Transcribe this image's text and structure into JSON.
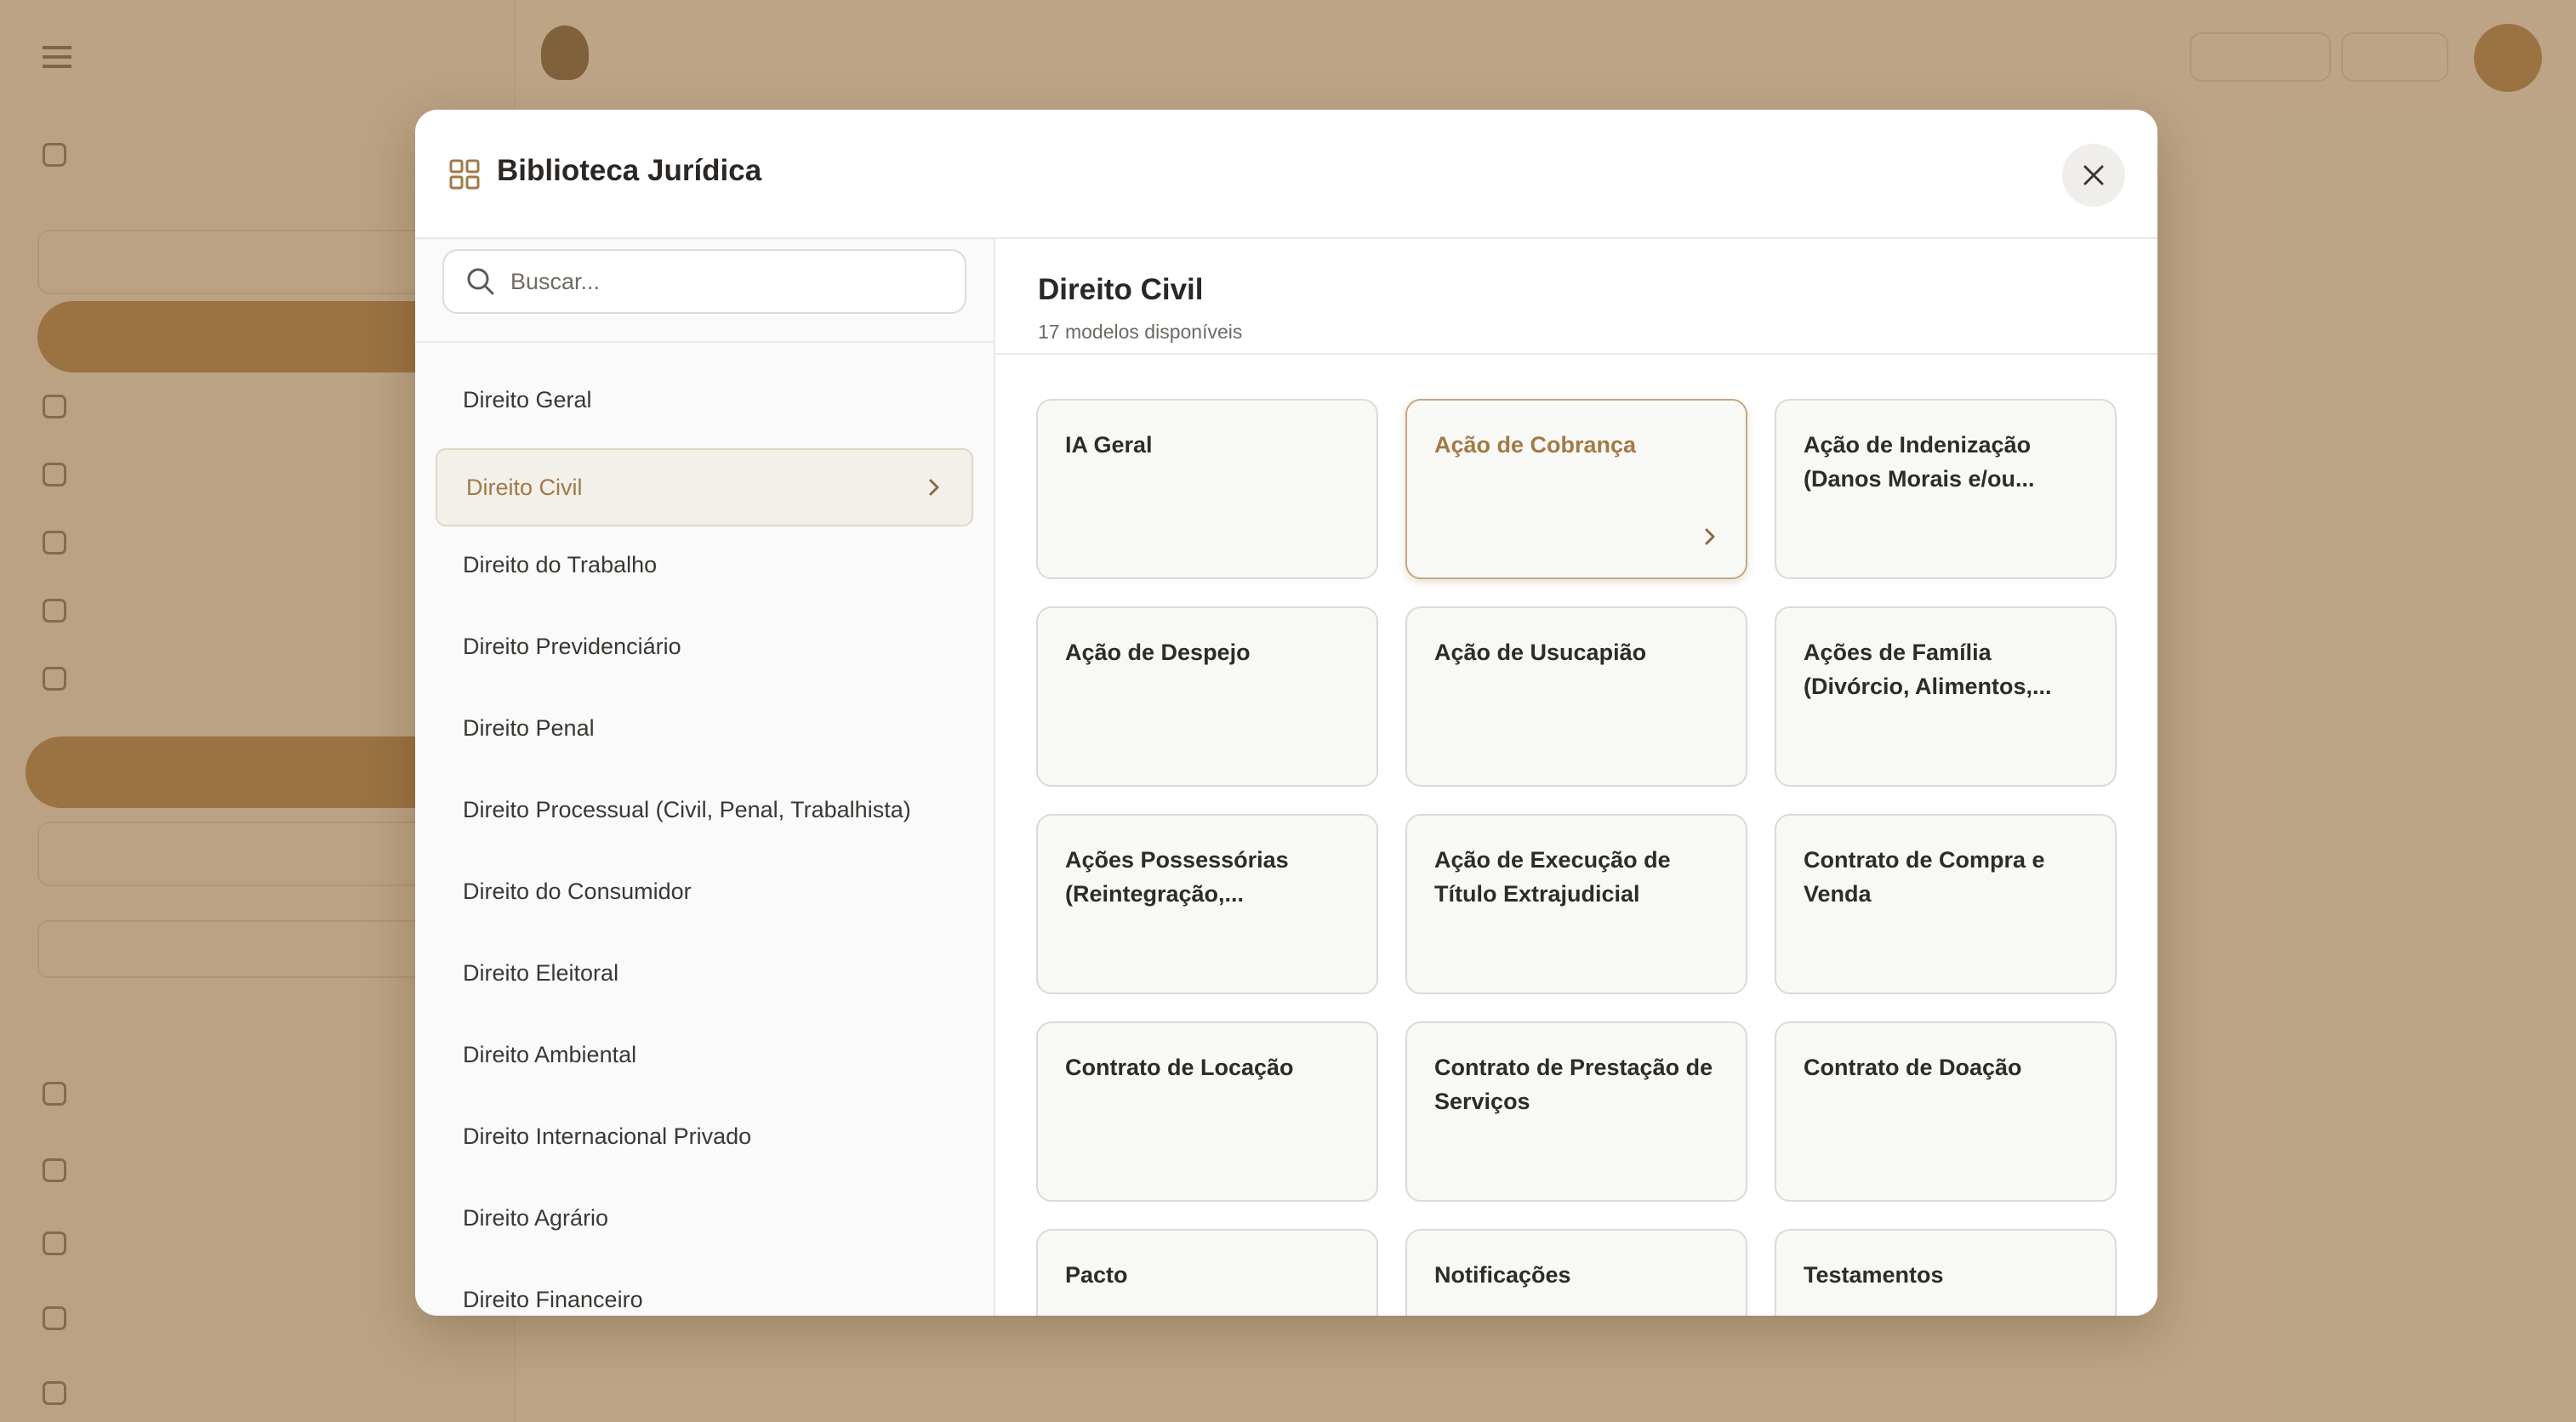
{
  "modal": {
    "title": "Biblioteca Jurídica",
    "search_placeholder": "Buscar...",
    "categories": [
      "Direito Geral",
      "Direito Civil",
      "Direito do Trabalho",
      "Direito Previdenciário",
      "Direito Penal",
      "Direito Processual (Civil, Penal, Trabalhista)",
      "Direito do Consumidor",
      "Direito Eleitoral",
      "Direito Ambiental",
      "Direito Internacional Privado",
      "Direito Agrário",
      "Direito Financeiro"
    ],
    "active_category": "Direito Civil",
    "section_title": "Direito Civil",
    "section_subtitle": "17 modelos disponíveis",
    "templates": [
      "IA Geral",
      "Ação de Cobrança",
      "Ação de Indenização (Danos Morais e/ou...",
      "Ação de Despejo",
      "Ação de Usucapião",
      "Ações de Família (Divórcio, Alimentos,...",
      "Ações Possessórias (Reintegração,...",
      "Ação de Execução de Título Extrajudicial",
      "Contrato de Compra e Venda",
      "Contrato de Locação",
      "Contrato de Prestação de Serviços",
      "Contrato de Doação",
      "Pacto",
      "Notificações",
      "Testamentos"
    ],
    "selected_template": "Ação de Cobrança"
  },
  "colors": {
    "accent": "#a27a45",
    "overlay": "#b8a283",
    "active_bg": "#f3efe9"
  },
  "icons": {
    "title_icon": "grid-icon",
    "close": "close-icon",
    "search": "search-icon",
    "chevron": "chevron-right-icon"
  }
}
